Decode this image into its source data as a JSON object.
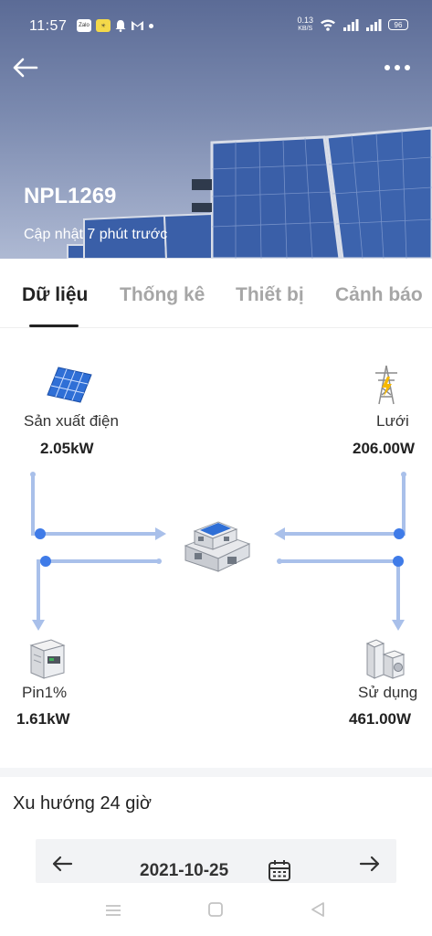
{
  "status_bar": {
    "time": "11:57",
    "net_speed_value": "0.13",
    "net_speed_unit": "KB/S",
    "battery": "96"
  },
  "header": {
    "plant_name": "NPL1269",
    "last_update": "Cập nhật 7 phút trước"
  },
  "tabs": [
    {
      "label": "Dữ liệu",
      "active": true
    },
    {
      "label": "Thống kê",
      "active": false
    },
    {
      "label": "Thiết bị",
      "active": false
    },
    {
      "label": "Cảnh báo",
      "active": false
    }
  ],
  "flow": {
    "production": {
      "label": "Sản xuất điện",
      "value": "2.05kW",
      "icon": "solar-panel-icon"
    },
    "grid": {
      "label": "Lưới",
      "value": "206.00W",
      "icon": "power-tower-icon"
    },
    "battery": {
      "label": "Pin1%",
      "value": "1.61kW",
      "icon": "battery-cabinet-icon"
    },
    "consumption": {
      "label": "Sử dụng",
      "value": "461.00W",
      "icon": "appliance-icon"
    },
    "house_icon": "house-icon",
    "line_color": "#a9c0ea",
    "dot_color": "#3f7be8"
  },
  "trend": {
    "title": "Xu hướng 24 giờ",
    "date": "2021-10-25"
  }
}
